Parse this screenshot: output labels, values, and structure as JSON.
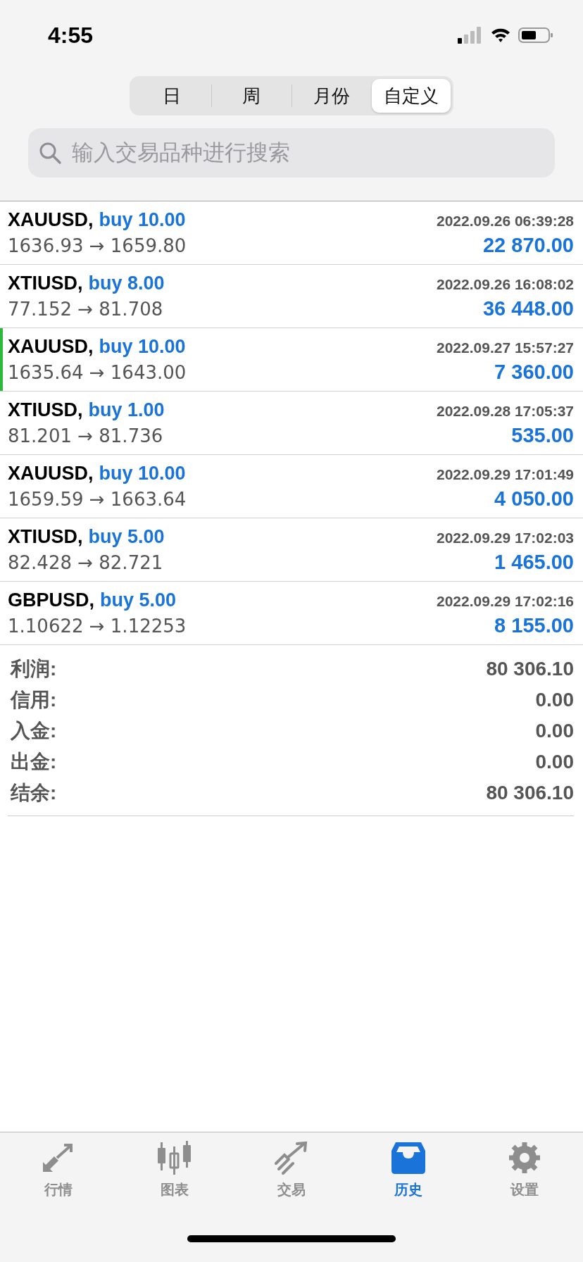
{
  "status_bar": {
    "time": "4:55"
  },
  "period_tabs": [
    {
      "label": "日",
      "selected": false
    },
    {
      "label": "周",
      "selected": false
    },
    {
      "label": "月份",
      "selected": false
    },
    {
      "label": "自定义",
      "selected": true
    }
  ],
  "search": {
    "placeholder": "输入交易品种进行搜索"
  },
  "trades": [
    {
      "symbol": "XAUUSD,",
      "side": "buy 10.00",
      "time": "2022.09.26 06:39:28",
      "prices": "1636.93 → 1659.80",
      "profit": "22 870.00",
      "highlighted": false
    },
    {
      "symbol": "XTIUSD,",
      "side": "buy 8.00",
      "time": "2022.09.26 16:08:02",
      "prices": "77.152 → 81.708",
      "profit": "36 448.00",
      "highlighted": false
    },
    {
      "symbol": "XAUUSD,",
      "side": "buy 10.00",
      "time": "2022.09.27 15:57:27",
      "prices": "1635.64 → 1643.00",
      "profit": "7 360.00",
      "highlighted": true
    },
    {
      "symbol": "XTIUSD,",
      "side": "buy 1.00",
      "time": "2022.09.28 17:05:37",
      "prices": "81.201 → 81.736",
      "profit": "535.00",
      "highlighted": false
    },
    {
      "symbol": "XAUUSD,",
      "side": "buy 10.00",
      "time": "2022.09.29 17:01:49",
      "prices": "1659.59 → 1663.64",
      "profit": "4 050.00",
      "highlighted": false
    },
    {
      "symbol": "XTIUSD,",
      "side": "buy 5.00",
      "time": "2022.09.29 17:02:03",
      "prices": "82.428 → 82.721",
      "profit": "1 465.00",
      "highlighted": false
    },
    {
      "symbol": "GBPUSD,",
      "side": "buy 5.00",
      "time": "2022.09.29 17:02:16",
      "prices": "1.10622 → 1.12253",
      "profit": "8 155.00",
      "highlighted": false
    }
  ],
  "summary": [
    {
      "label": "利润:",
      "value": "80 306.10"
    },
    {
      "label": "信用:",
      "value": "0.00"
    },
    {
      "label": "入金:",
      "value": "0.00"
    },
    {
      "label": "出金:",
      "value": "0.00"
    },
    {
      "label": "结余:",
      "value": "80 306.10"
    }
  ],
  "tab_bar": [
    {
      "kind": "quotes",
      "label": "行情",
      "selected": false
    },
    {
      "kind": "chart",
      "label": "图表",
      "selected": false
    },
    {
      "kind": "trade",
      "label": "交易",
      "selected": false
    },
    {
      "kind": "history",
      "label": "历史",
      "selected": true
    },
    {
      "kind": "settings",
      "label": "设置",
      "selected": false
    }
  ]
}
